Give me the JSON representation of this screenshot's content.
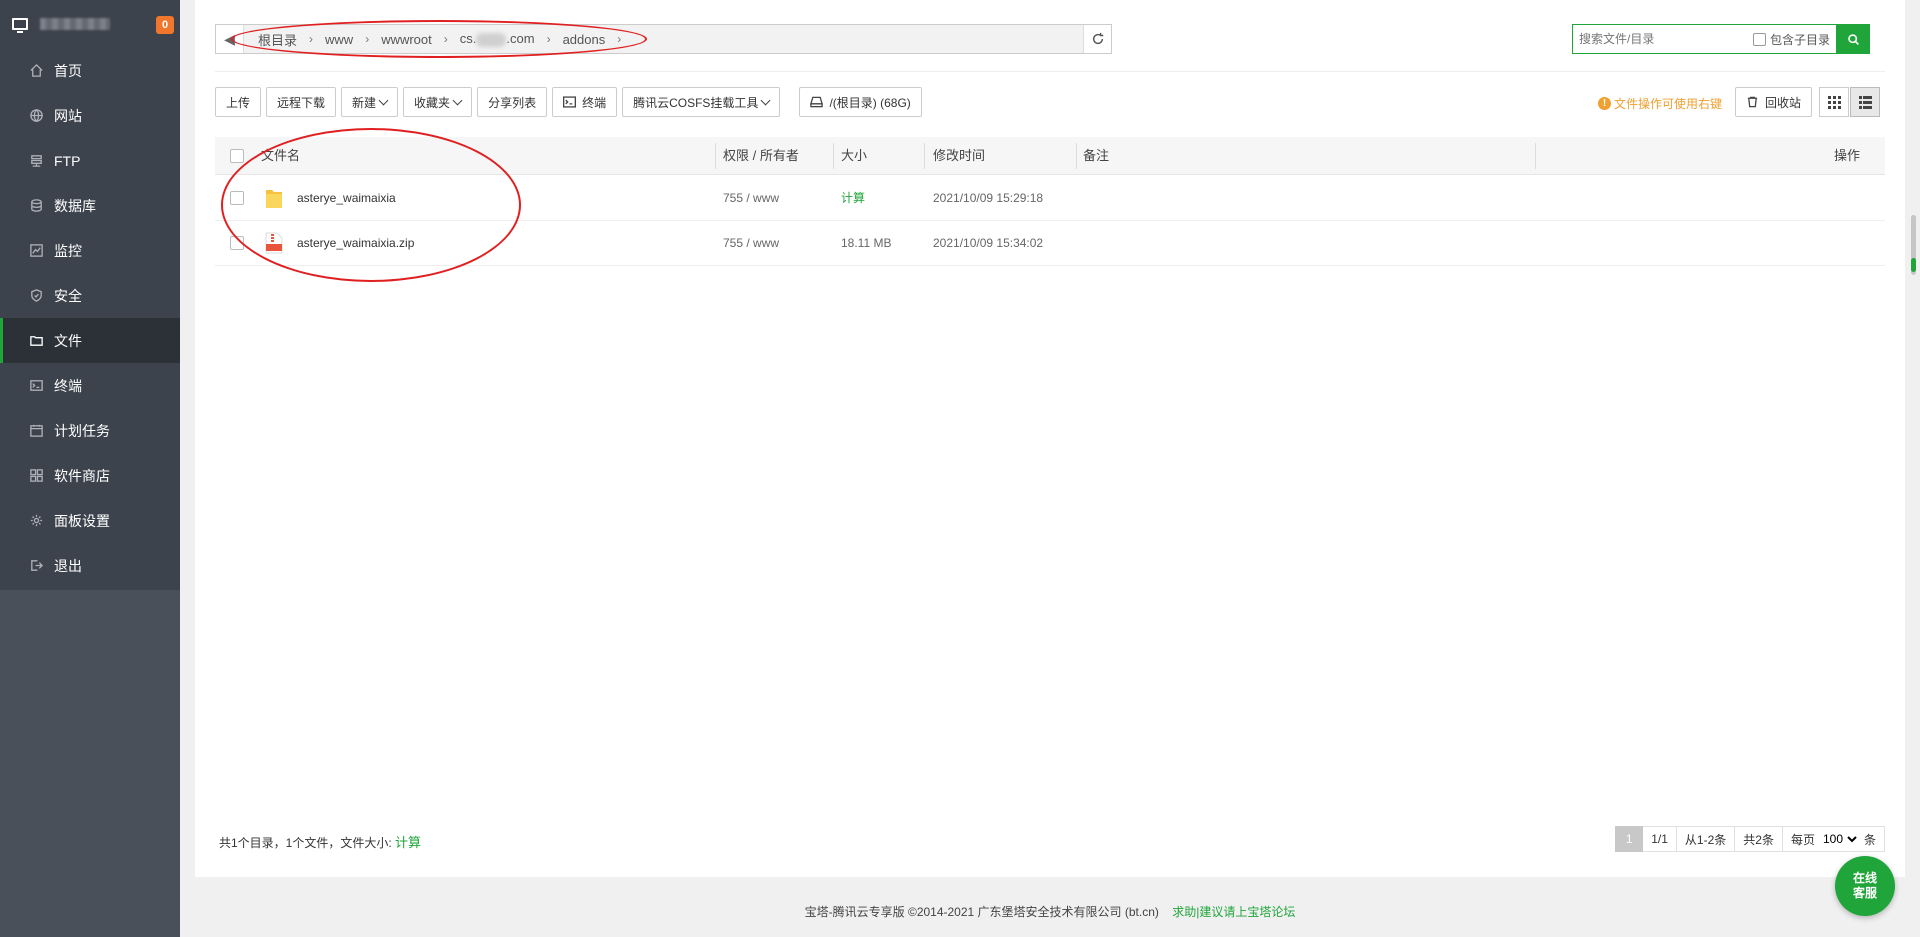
{
  "sidebar": {
    "badge": "0",
    "items": [
      {
        "label": "首页",
        "icon": "home-icon"
      },
      {
        "label": "网站",
        "icon": "globe-icon"
      },
      {
        "label": "FTP",
        "icon": "ftp-icon"
      },
      {
        "label": "数据库",
        "icon": "database-icon"
      },
      {
        "label": "监控",
        "icon": "monitor-chart-icon"
      },
      {
        "label": "安全",
        "icon": "shield-icon"
      },
      {
        "label": "文件",
        "icon": "folder-icon"
      },
      {
        "label": "终端",
        "icon": "terminal-icon"
      },
      {
        "label": "计划任务",
        "icon": "calendar-icon"
      },
      {
        "label": "软件商店",
        "icon": "apps-icon"
      },
      {
        "label": "面板设置",
        "icon": "gear-icon"
      },
      {
        "label": "退出",
        "icon": "logout-icon"
      }
    ],
    "active_index": 6
  },
  "path": {
    "crumbs": [
      "根目录",
      "www",
      "wwwroot",
      "cs.",
      ".com",
      "addons"
    ]
  },
  "search": {
    "placeholder": "搜索文件/目录",
    "subdir_label": "包含子目录"
  },
  "toolbar": {
    "upload": "上传",
    "remote_download": "远程下载",
    "new": "新建",
    "favorites": "收藏夹",
    "share_list": "分享列表",
    "terminal": "终端",
    "cosfs": "腾讯云COSFS挂载工具",
    "disk": "/(根目录) (68G)",
    "tip": "文件操作可使用右键",
    "recycle": "回收站"
  },
  "table": {
    "headers": {
      "name": "文件名",
      "perm": "权限 / 所有者",
      "size": "大小",
      "mtime": "修改时间",
      "note": "备注",
      "ops": "操作"
    },
    "rows": [
      {
        "name": "asterye_waimaixia",
        "type": "folder",
        "perm": "755 / www",
        "size": "计算",
        "mtime": "2021/10/09 15:29:18"
      },
      {
        "name": "asterye_waimaixia.zip",
        "type": "zip",
        "perm": "755 / www",
        "size": "18.11 MB",
        "mtime": "2021/10/09 15:34:02"
      }
    ]
  },
  "summary": {
    "text": "共1个目录，1个文件，文件大小:",
    "calc": "计算"
  },
  "pager": {
    "current": "1",
    "pages": "1/1",
    "range": "从1-2条",
    "total": "共2条",
    "per_page_label": "每页",
    "per_page_value": "100",
    "unit": "条"
  },
  "footer": {
    "copyright": "宝塔-腾讯云专享版 ©2014-2021 广东堡塔安全技术有限公司 (bt.cn)",
    "forum_link": "求助|建议请上宝塔论坛"
  },
  "chat": {
    "line1": "在线",
    "line2": "客服"
  },
  "colors": {
    "accent": "#20a53a",
    "sidebar_bg": "#3d434d",
    "annotation_red": "#e02020",
    "tip_orange": "#f0a030"
  }
}
